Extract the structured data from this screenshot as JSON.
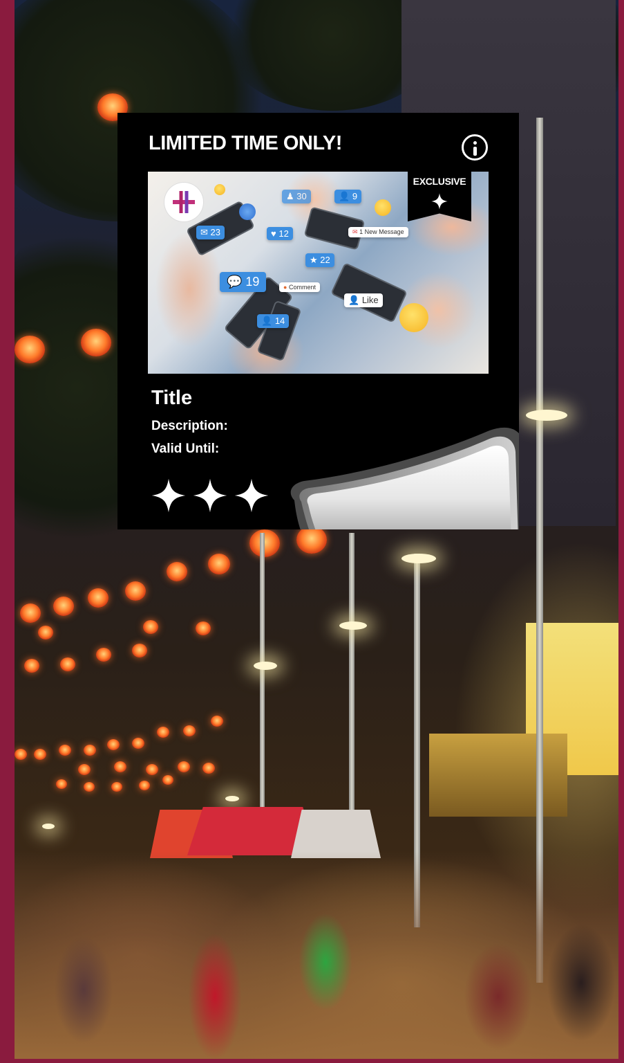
{
  "coupon": {
    "heading": "LIMITED TIME ONLY!",
    "badge": "EXCLUSIVE",
    "title": "Title",
    "description_label": "Description:",
    "valid_until_label": "Valid Until:",
    "rating_stars": 3
  },
  "image": {
    "notifications": {
      "mail_count": "23",
      "messages_count": "19",
      "users_count": "9",
      "star_count": "22",
      "profile_count": "14",
      "like_label": "Like",
      "comment_label": "Comment",
      "message_label": "1 New Message",
      "likes_count": "30",
      "hearts_count": "12"
    }
  },
  "colors": {
    "frame": "#8a1b3e",
    "card": "#000000",
    "text": "#ffffff",
    "notification": "#3c8ee0"
  },
  "icons": [
    "info-icon",
    "exclusive-star-icon",
    "rating-star-icon",
    "peel-sticker-icon",
    "brand-logo"
  ]
}
